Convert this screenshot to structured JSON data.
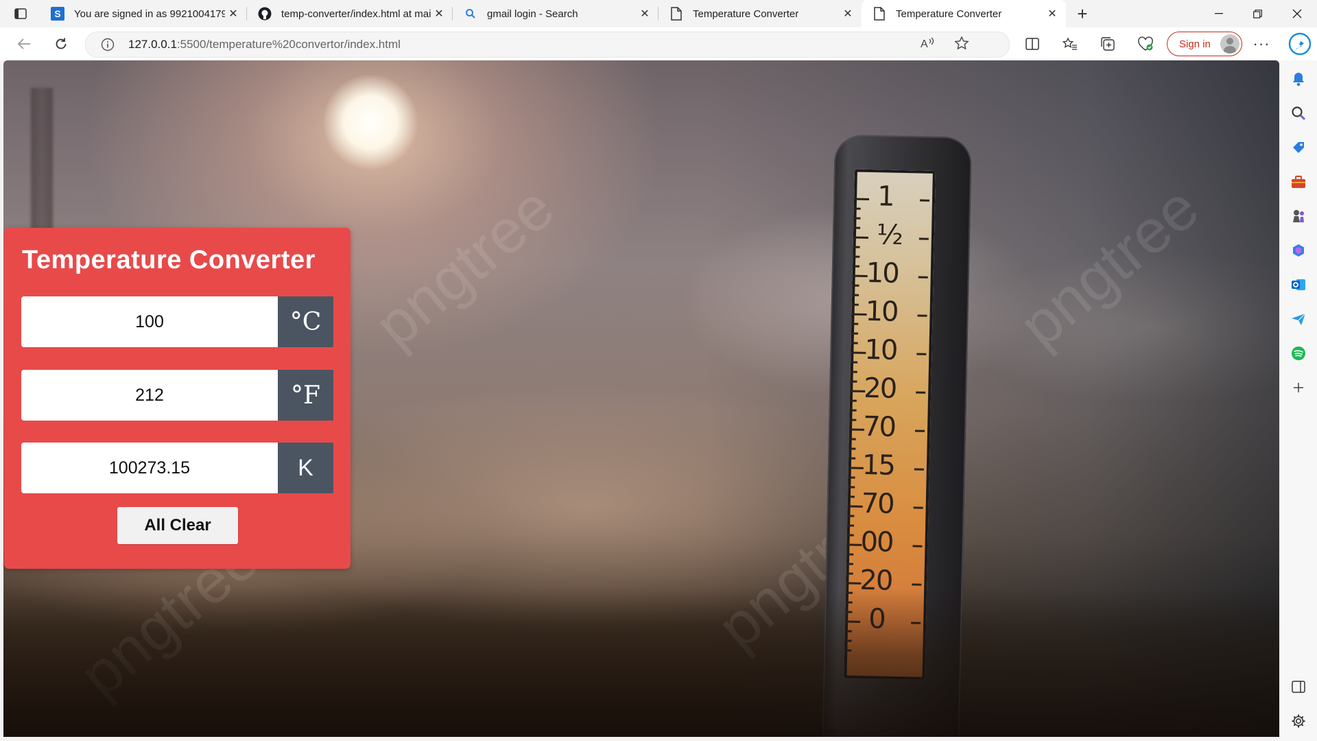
{
  "browser": {
    "tabs": [
      {
        "title": "You are signed in as 9921004179",
        "icon": "s-logo-icon"
      },
      {
        "title": "temp-converter/index.html at main",
        "icon": "github-icon"
      },
      {
        "title": "gmail login - Search",
        "icon": "search-icon"
      },
      {
        "title": "Temperature Converter",
        "icon": "page-icon"
      },
      {
        "title": "Temperature Converter",
        "icon": "page-icon",
        "active": true
      }
    ],
    "url_host": "127.0.0.1",
    "url_rest": ":5500/temperature%20convertor/index.html",
    "signin_label": "Sign in"
  },
  "converter": {
    "title": "Temperature Converter",
    "celsius": "100",
    "celsius_unit": "°C",
    "fahrenheit": "212",
    "fahrenheit_unit": "°F",
    "kelvin": "100273.15",
    "kelvin_unit": "K",
    "clear_label": "All Clear",
    "accent_color": "#e84a4a",
    "unit_bg_color": "#4a5561"
  },
  "background": {
    "thermometer_numbers": [
      "1",
      "½",
      "10",
      "10",
      "10",
      "20",
      "70",
      "15",
      "70",
      "00",
      "20",
      "0"
    ],
    "watermark": "pngtree"
  }
}
